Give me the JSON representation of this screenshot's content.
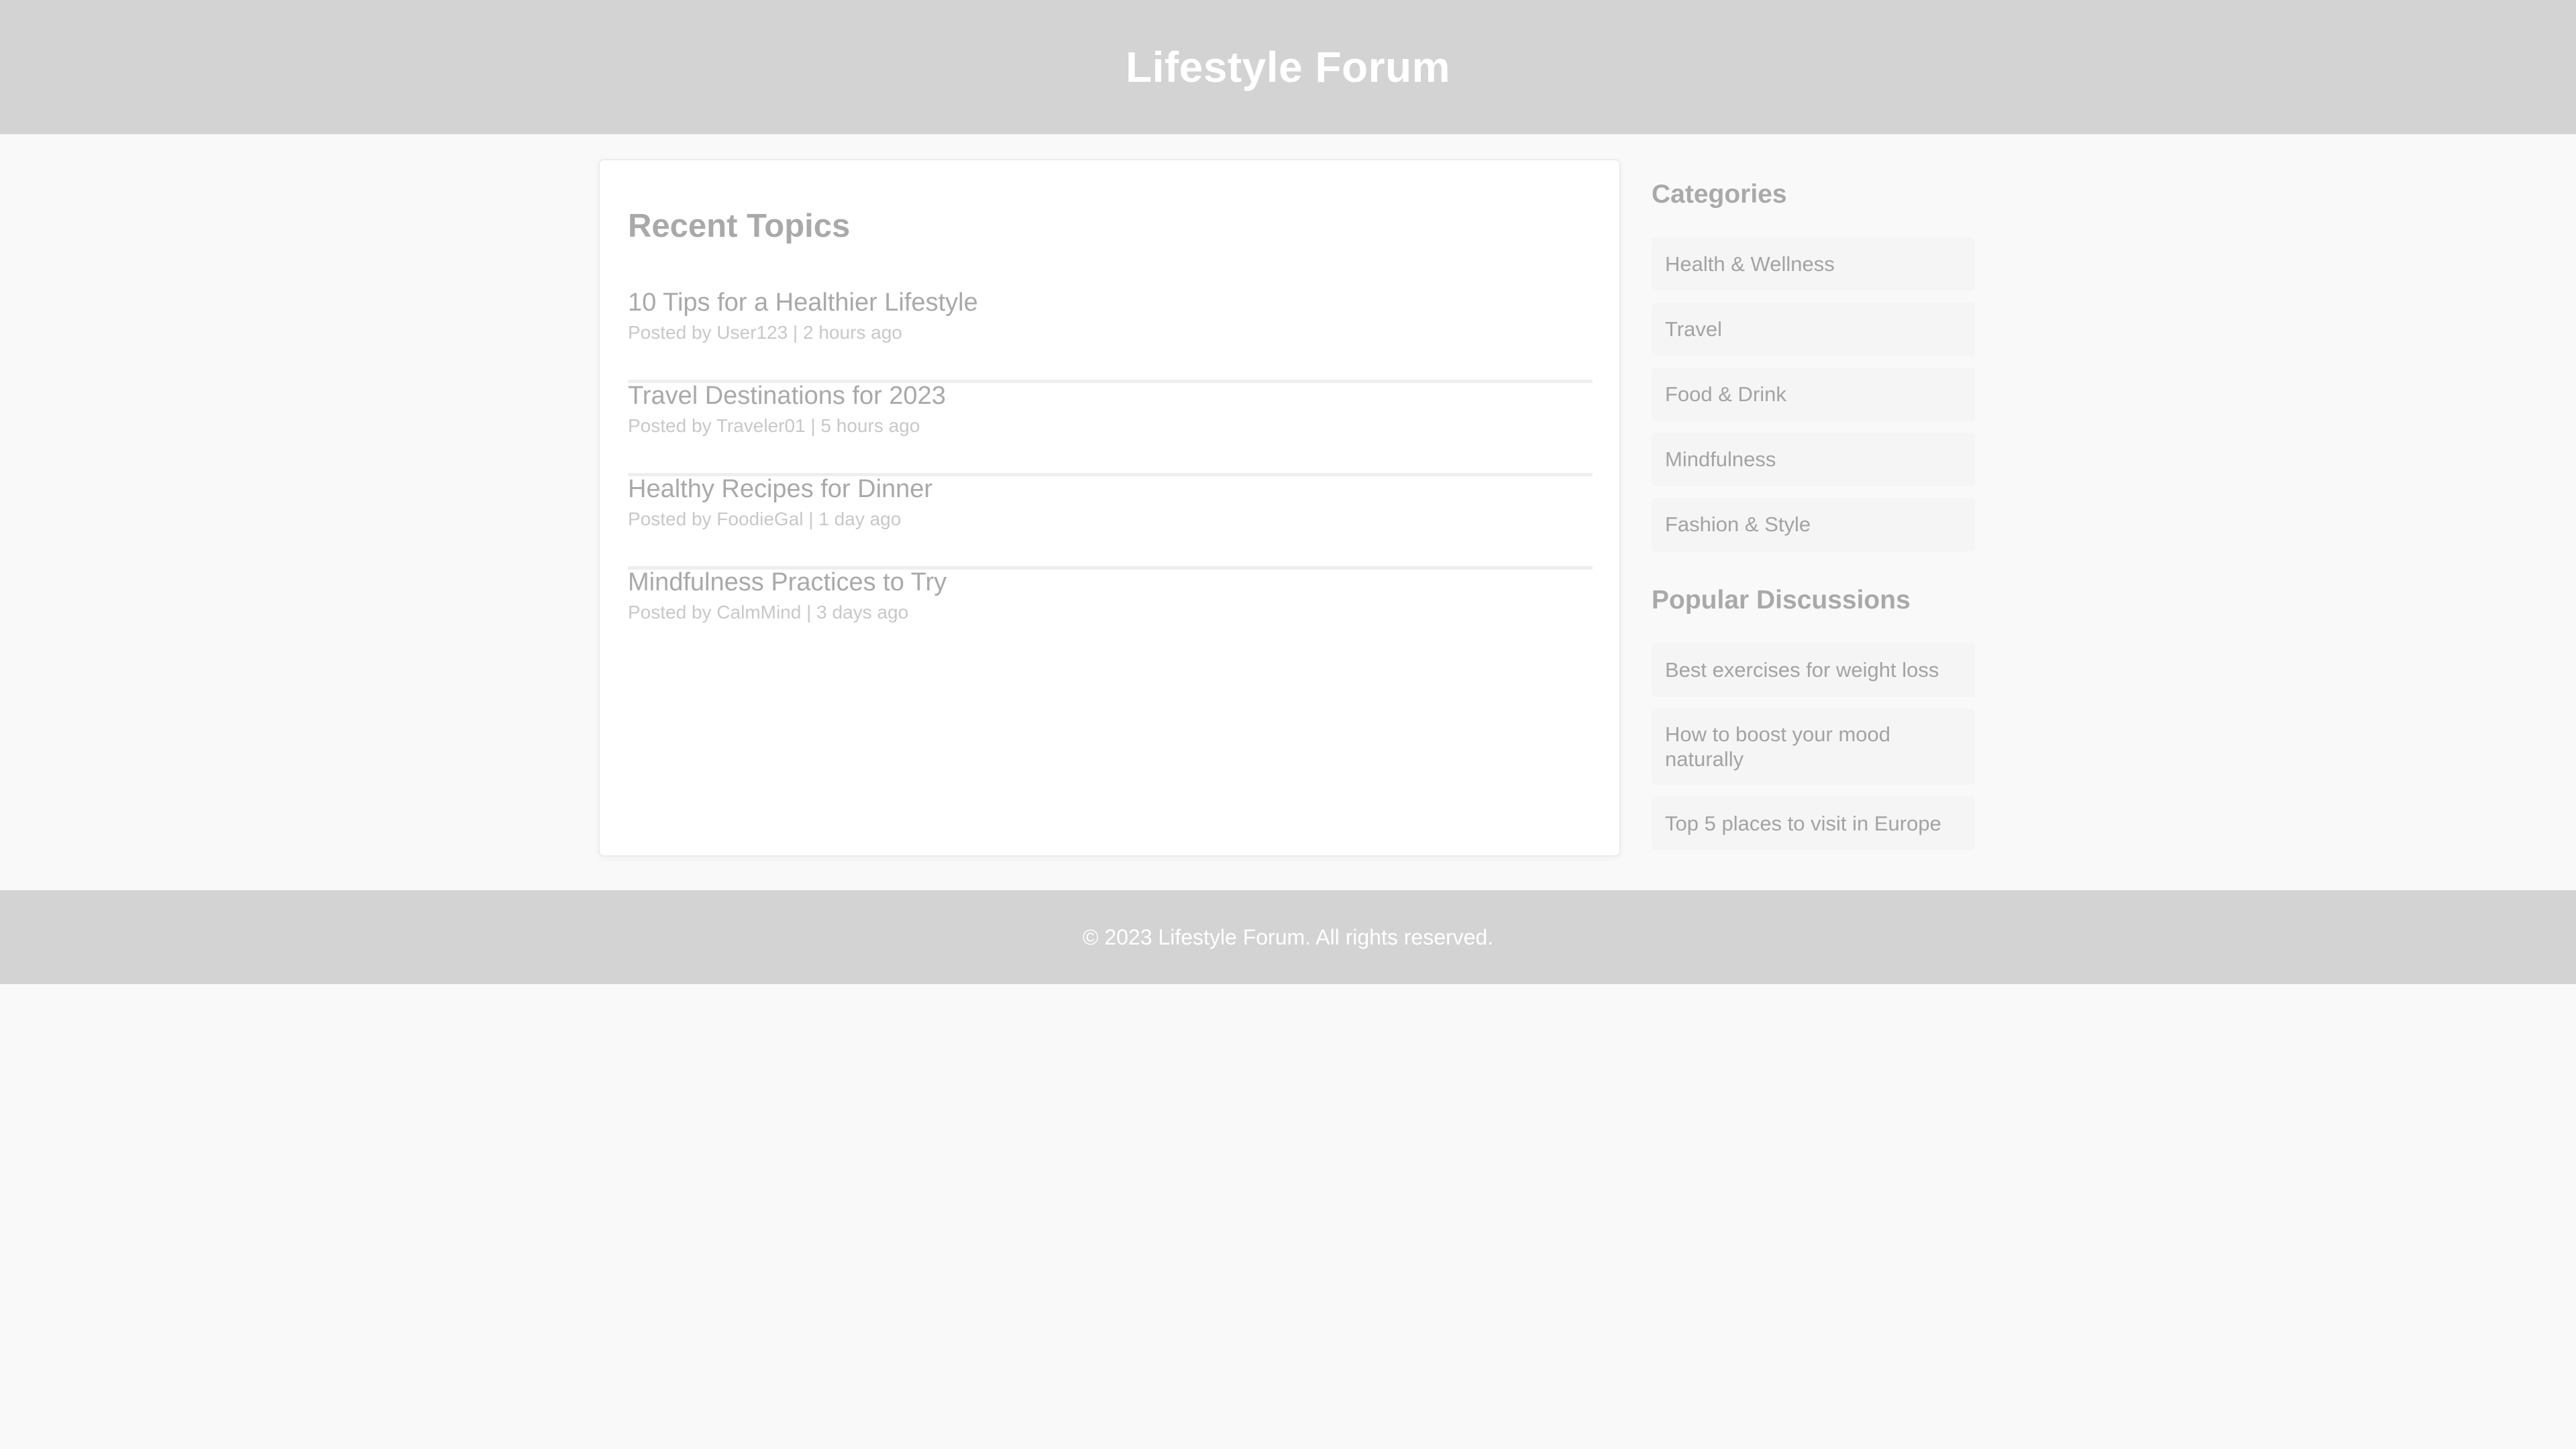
{
  "header": {
    "title": "Lifestyle Forum"
  },
  "recent_topics": {
    "heading": "Recent Topics",
    "items": [
      {
        "title": "10 Tips for a Healthier Lifestyle",
        "meta": "Posted by User123 | 2 hours ago"
      },
      {
        "title": "Travel Destinations for 2023",
        "meta": "Posted by Traveler01 | 5 hours ago"
      },
      {
        "title": "Healthy Recipes for Dinner",
        "meta": "Posted by FoodieGal | 1 day ago"
      },
      {
        "title": "Mindfulness Practices to Try",
        "meta": "Posted by CalmMind | 3 days ago"
      }
    ]
  },
  "sidebar": {
    "categories_heading": "Categories",
    "categories": [
      {
        "label": "Health & Wellness"
      },
      {
        "label": "Travel"
      },
      {
        "label": "Food & Drink"
      },
      {
        "label": "Mindfulness"
      },
      {
        "label": "Fashion & Style"
      }
    ],
    "popular_heading": "Popular Discussions",
    "popular": [
      {
        "label": "Best exercises for weight loss"
      },
      {
        "label": "How to boost your mood naturally"
      },
      {
        "label": "Top 5 places to visit in Europe"
      }
    ]
  },
  "footer": {
    "text": "© 2023 Lifestyle Forum. All rights reserved."
  },
  "colors": {
    "header_bg": "#d3d3d3",
    "page_bg": "#f9f9f9",
    "panel_bg": "#ffffff",
    "heading_text": "#a9a9a9",
    "sidebar_item_bg": "#f5f5f5",
    "footer_text": "#ffffff"
  }
}
